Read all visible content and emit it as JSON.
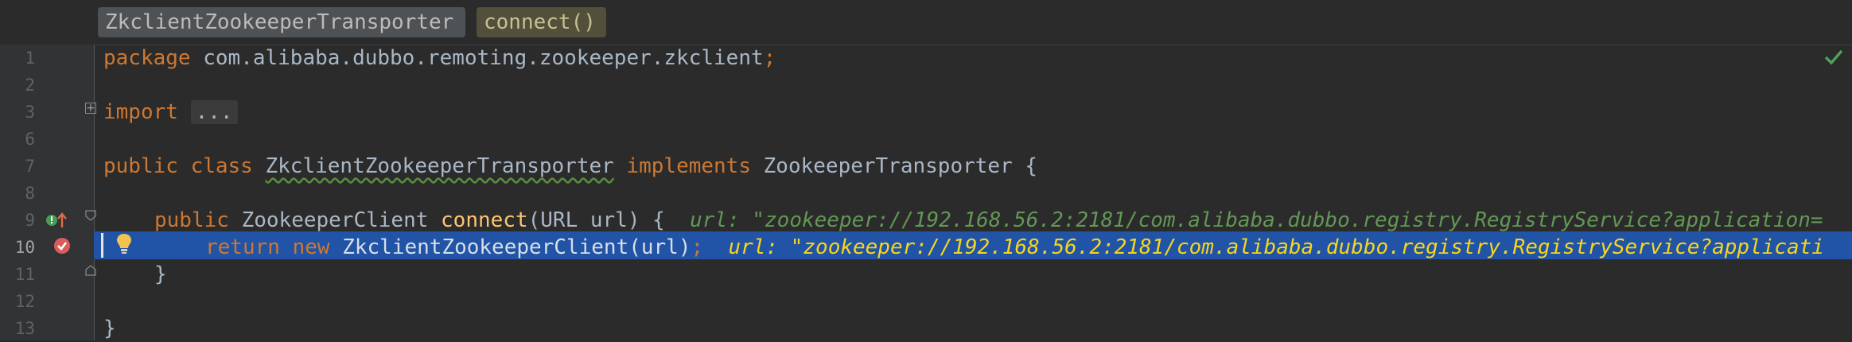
{
  "breadcrumbs": [
    {
      "label": "ZkclientZookeeperTransporter"
    },
    {
      "label": "connect()"
    }
  ],
  "line_numbers": [
    "1",
    "2",
    "3",
    "6",
    "7",
    "8",
    "9",
    "10",
    "11",
    "12",
    "13"
  ],
  "code": {
    "l1_kw": "package",
    "l1_rest": " com.alibaba.dubbo.remoting.zookeeper.zkclient",
    "l1_semi": ";",
    "l3_kw": "import",
    "l3_fold": "...",
    "l7_kw1": "public class",
    "l7_cls": "ZkclientZookeeperTransporter",
    "l7_kw2": "implements",
    "l7_rest": " ZookeeperTransporter {",
    "l9_kw": "public",
    "l9_type": " ZookeeperClient ",
    "l9_fn": "connect",
    "l9_params": "(URL url) {",
    "l9_hint": "url: \"zookeeper://192.168.56.2:2181/com.alibaba.dubbo.registry.RegistryService?application=",
    "l10_kw": "return new",
    "l10_rest": " ZkclientZookeeperClient(url)",
    "l10_semi": ";",
    "l10_hint": "url: \"zookeeper://192.168.56.2:2181/com.alibaba.dubbo.registry.RegistryService?applicati",
    "l11": "}",
    "l13": "}"
  },
  "colors": {
    "background": "#2b2b2b",
    "keyword": "#cc7832",
    "method": "#ffc66d",
    "selection": "#2154a6",
    "inline_hint": "#629755",
    "selected_hint": "#f7d51d"
  }
}
